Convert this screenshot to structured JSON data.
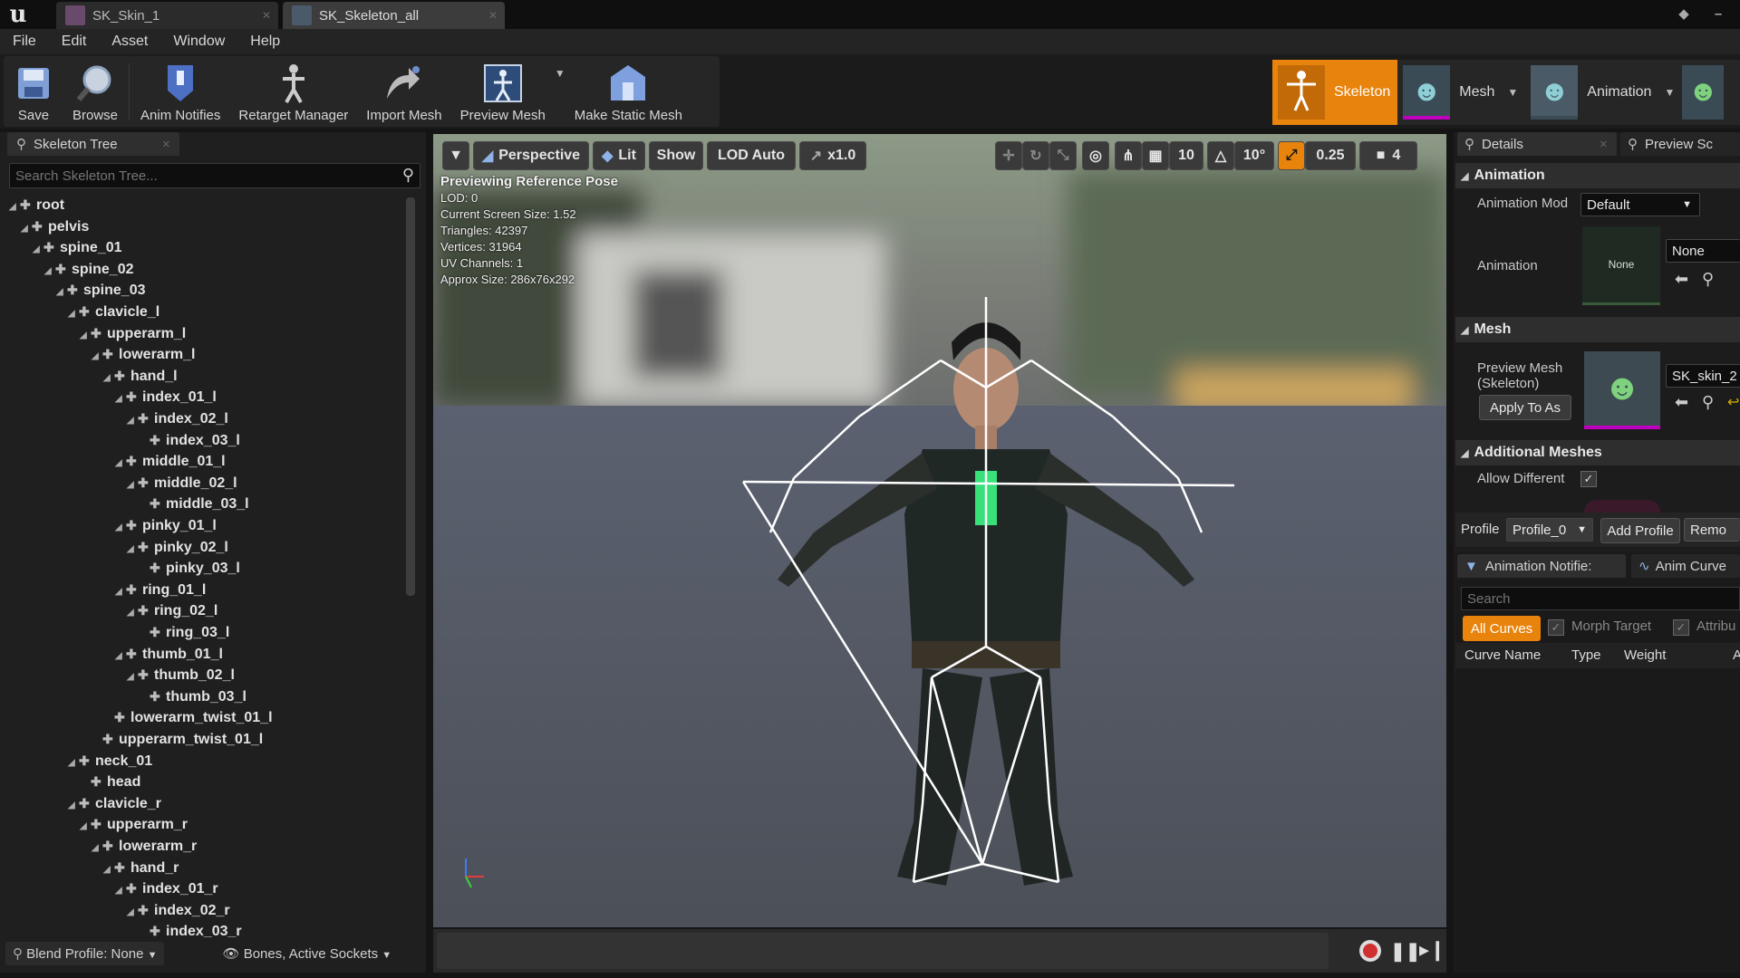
{
  "tabs": [
    {
      "label": "SK_Skin_1"
    },
    {
      "label": "SK_Skeleton_all"
    }
  ],
  "menu": [
    "File",
    "Edit",
    "Asset",
    "Window",
    "Help"
  ],
  "toolbar": {
    "tools": [
      {
        "label": "Save",
        "icon": "save-icon"
      },
      {
        "label": "Browse",
        "icon": "browse-icon"
      },
      {
        "label": "Anim Notifies",
        "icon": "anim-notifies-icon"
      },
      {
        "label": "Retarget Manager",
        "icon": "retarget-icon"
      },
      {
        "label": "Import Mesh",
        "icon": "import-mesh-icon"
      },
      {
        "label": "Preview Mesh",
        "icon": "preview-mesh-icon"
      },
      {
        "label": "Make Static Mesh",
        "icon": "make-static-mesh-icon"
      }
    ]
  },
  "modes": [
    {
      "label": "Skeleton",
      "active": true
    },
    {
      "label": "Mesh",
      "active": false
    },
    {
      "label": "Animation",
      "active": false
    }
  ],
  "skeleton_tree": {
    "tab_label": "Skeleton Tree",
    "search_placeholder": "Search Skeleton Tree...",
    "bones": [
      {
        "name": "root",
        "depth": 0,
        "expandable": true
      },
      {
        "name": "pelvis",
        "depth": 1,
        "expandable": true
      },
      {
        "name": "spine_01",
        "depth": 2,
        "expandable": true
      },
      {
        "name": "spine_02",
        "depth": 3,
        "expandable": true
      },
      {
        "name": "spine_03",
        "depth": 4,
        "expandable": true
      },
      {
        "name": "clavicle_l",
        "depth": 5,
        "expandable": true
      },
      {
        "name": "upperarm_l",
        "depth": 6,
        "expandable": true
      },
      {
        "name": "lowerarm_l",
        "depth": 7,
        "expandable": true
      },
      {
        "name": "hand_l",
        "depth": 8,
        "expandable": true
      },
      {
        "name": "index_01_l",
        "depth": 9,
        "expandable": true
      },
      {
        "name": "index_02_l",
        "depth": 10,
        "expandable": true
      },
      {
        "name": "index_03_l",
        "depth": 11,
        "expandable": false
      },
      {
        "name": "middle_01_l",
        "depth": 9,
        "expandable": true
      },
      {
        "name": "middle_02_l",
        "depth": 10,
        "expandable": true
      },
      {
        "name": "middle_03_l",
        "depth": 11,
        "expandable": false
      },
      {
        "name": "pinky_01_l",
        "depth": 9,
        "expandable": true
      },
      {
        "name": "pinky_02_l",
        "depth": 10,
        "expandable": true
      },
      {
        "name": "pinky_03_l",
        "depth": 11,
        "expandable": false
      },
      {
        "name": "ring_01_l",
        "depth": 9,
        "expandable": true
      },
      {
        "name": "ring_02_l",
        "depth": 10,
        "expandable": true
      },
      {
        "name": "ring_03_l",
        "depth": 11,
        "expandable": false
      },
      {
        "name": "thumb_01_l",
        "depth": 9,
        "expandable": true
      },
      {
        "name": "thumb_02_l",
        "depth": 10,
        "expandable": true
      },
      {
        "name": "thumb_03_l",
        "depth": 11,
        "expandable": false
      },
      {
        "name": "lowerarm_twist_01_l",
        "depth": 8,
        "expandable": false
      },
      {
        "name": "upperarm_twist_01_l",
        "depth": 7,
        "expandable": false
      },
      {
        "name": "neck_01",
        "depth": 5,
        "expandable": true
      },
      {
        "name": "head",
        "depth": 6,
        "expandable": false
      },
      {
        "name": "clavicle_r",
        "depth": 5,
        "expandable": true
      },
      {
        "name": "upperarm_r",
        "depth": 6,
        "expandable": true
      },
      {
        "name": "lowerarm_r",
        "depth": 7,
        "expandable": true
      },
      {
        "name": "hand_r",
        "depth": 8,
        "expandable": true
      },
      {
        "name": "index_01_r",
        "depth": 9,
        "expandable": true
      },
      {
        "name": "index_02_r",
        "depth": 10,
        "expandable": true
      },
      {
        "name": "index_03_r",
        "depth": 11,
        "expandable": false
      }
    ],
    "blend_profile": "Blend Profile: None",
    "filter": "Bones, Active Sockets"
  },
  "viewport": {
    "view_mode": "Perspective",
    "lighting": "Lit",
    "show": "Show",
    "lod": "LOD Auto",
    "speed": "x1.0",
    "grid_snap": "10",
    "rot_snap": "10°",
    "scale_snap": "0.25",
    "camera_speed": "4",
    "stats": {
      "title": "Previewing Reference Pose",
      "lines": [
        "LOD: 0",
        "Current Screen Size: 1.52",
        "Triangles: 42397",
        "Vertices: 31964",
        "UV Channels: 1",
        "Approx Size: 286x76x292"
      ]
    }
  },
  "details": {
    "tab_label": "Details",
    "tab2_label": "Preview Sc",
    "animation_section": "Animation",
    "animation_mode_label": "Animation Mod",
    "animation_mode_value": "Default",
    "animation_label": "Animation",
    "animation_thumb_text": "None",
    "animation_value": "None",
    "mesh_section": "Mesh",
    "preview_mesh_label": "Preview Mesh (Skeleton)",
    "preview_mesh_value": "SK_skin_2",
    "apply_button": "Apply To As",
    "additional_section": "Additional Meshes",
    "allow_different_label": "Allow Different",
    "profile_label": "Profile",
    "profile_value": "Profile_0",
    "add_profile": "Add Profile",
    "remove_profile": "Remo"
  },
  "curves": {
    "tab1": "Animation Notifie:",
    "tab2": "Anim Curve",
    "search_placeholder": "Search",
    "all_curves": "All Curves",
    "morph_target": "Morph Target",
    "attribute": "Attribu",
    "columns": [
      "Curve Name",
      "Type",
      "Weight",
      "A"
    ]
  },
  "colors": {
    "accent": "#e8830c",
    "panel": "#1f1f1f",
    "toolbar": "#262626",
    "magenta_underline": "#c000c0"
  }
}
